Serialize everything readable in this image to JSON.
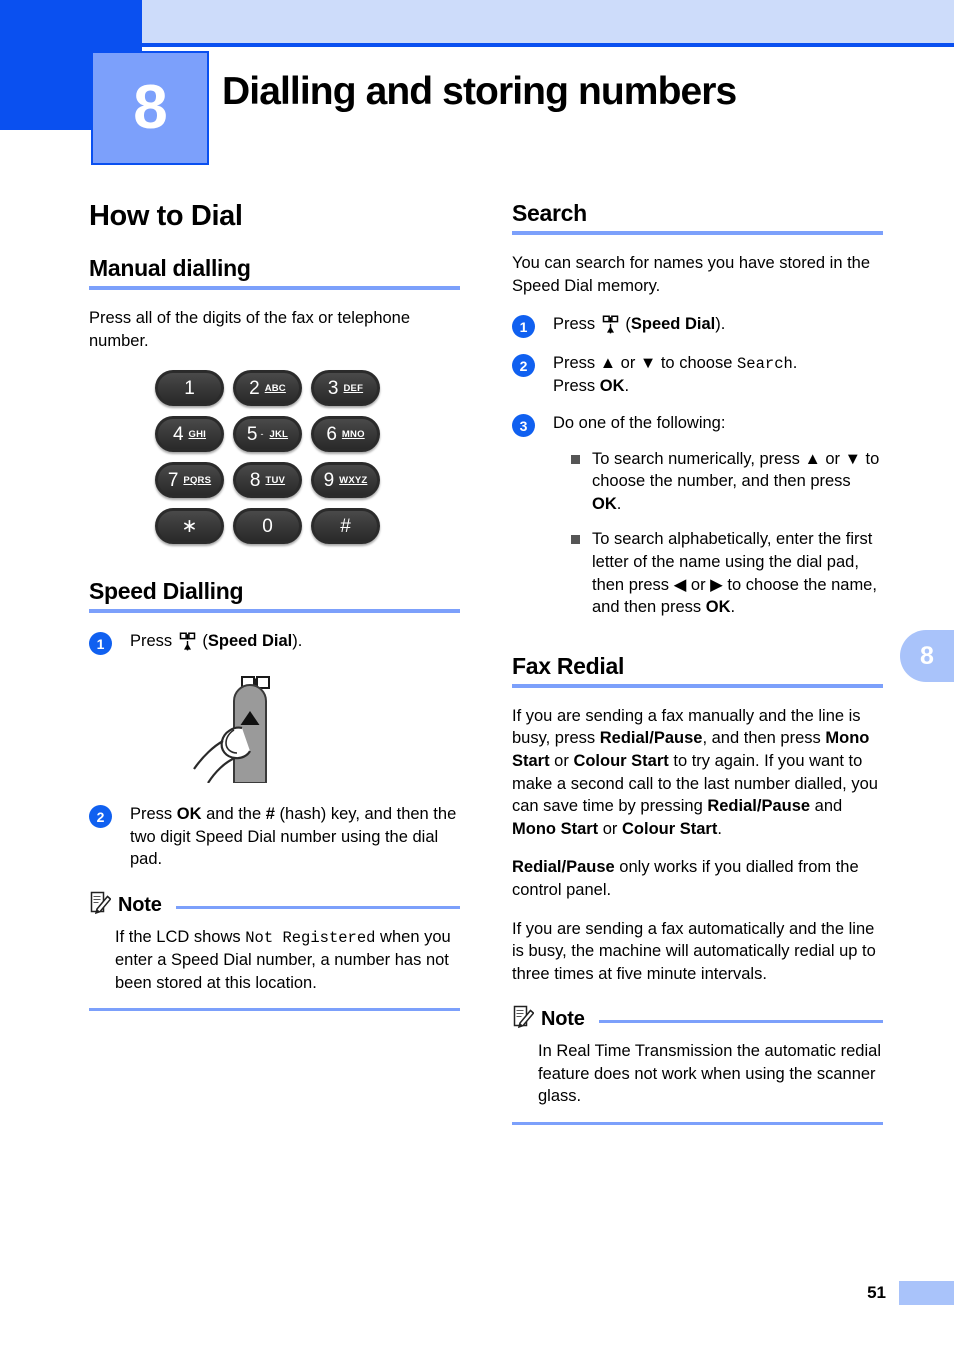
{
  "header": {
    "chapter_number": "8",
    "chapter_title": "Dialling and storing numbers"
  },
  "side_tab": {
    "label": "8"
  },
  "footer": {
    "page_number": "51"
  },
  "left_column": {
    "h1": "How to Dial",
    "manual": {
      "heading": "Manual dialling",
      "paragraph": "Press all of the digits of the fax or telephone number.",
      "keypad": {
        "rows": [
          [
            {
              "main": "1",
              "sub": ""
            },
            {
              "main": "2",
              "sub": "ABC"
            },
            {
              "main": "3",
              "sub": "DEF"
            }
          ],
          [
            {
              "main": "4",
              "sub": "GHI"
            },
            {
              "main": "5",
              "sub": "JKL",
              "dot": "-"
            },
            {
              "main": "6",
              "sub": "MNO"
            }
          ],
          [
            {
              "main": "7",
              "sub": "PQRS"
            },
            {
              "main": "8",
              "sub": "TUV"
            },
            {
              "main": "9",
              "sub": "WXYZ"
            }
          ],
          [
            {
              "main": "∗",
              "sub": ""
            },
            {
              "main": "0",
              "sub": ""
            },
            {
              "main": "#",
              "sub": ""
            }
          ]
        ]
      }
    },
    "speed": {
      "heading": "Speed Dialling",
      "step1": {
        "badge": "1",
        "pre": "Press ",
        "post_open": " (",
        "bold": "Speed Dial",
        "post_close": ")."
      },
      "step2": {
        "badge": "2",
        "t1": "Press ",
        "b1": "OK",
        "t2": " and the ",
        "b2": "#",
        "t3": " (hash) key, and then the two digit Speed Dial number using the dial pad."
      },
      "note": {
        "title": "Note",
        "t1": "If the LCD shows ",
        "code": "Not Registered",
        "t2": " when you enter a Speed Dial number, a number has not been stored at this location."
      }
    }
  },
  "right_column": {
    "search": {
      "heading": "Search",
      "paragraph": "You can search for names you have stored in the Speed Dial memory.",
      "step1": {
        "badge": "1",
        "pre": "Press ",
        "post_open": " (",
        "bold": "Speed Dial",
        "post_close": ")."
      },
      "step2": {
        "badge": "2",
        "t1": "Press ▲ or ▼ to choose ",
        "code": "Search",
        "t2": ".",
        "t3": "Press ",
        "b1": "OK",
        "t4": "."
      },
      "step3": {
        "badge": "3",
        "lead": "Do one of the following:",
        "bullets": [
          {
            "t1": "To search numerically, press ▲ or ▼ to choose the number, and then press ",
            "b1": "OK",
            "t2": "."
          },
          {
            "t1": "To search alphabetically, enter the first letter of the name using the dial pad, then press ◀ or ▶ to choose the name, and then press ",
            "b1": "OK",
            "t2": "."
          }
        ]
      }
    },
    "fax_redial": {
      "heading": "Fax Redial",
      "p1": {
        "t1": "If you are sending a fax manually and the line is busy, press ",
        "b1": "Redial/Pause",
        "t2": ", and then press ",
        "b2": "Mono Start",
        "t3": " or ",
        "b3": "Colour Start",
        "t4": " to try again. If you want to make a second call to the last number dialled, you can save time by pressing ",
        "b4": "Redial/Pause",
        "t5": " and ",
        "b5": "Mono Start",
        "t6": " or ",
        "b6": "Colour Start",
        "t7": "."
      },
      "p2": {
        "b1": "Redial/Pause",
        "t1": " only works if you dialled from the control panel."
      },
      "p3": "If you are sending a fax automatically and the line is busy, the machine will automatically redial up to three times at five minute intervals.",
      "note": {
        "title": "Note",
        "text": "In Real Time Transmission the automatic redial feature does not work when using the scanner glass."
      }
    }
  },
  "colors": {
    "brand_blue": "#0A50F0",
    "band_blue": "#CDDCFA",
    "rule_blue": "#7CA0FB",
    "tab_blue": "#A9C3FA"
  }
}
